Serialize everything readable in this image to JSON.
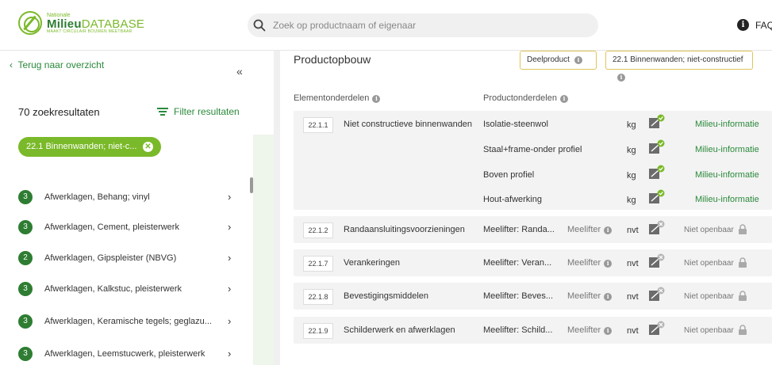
{
  "header": {
    "logo_small": "Nationale",
    "logo_brand": "Milieu",
    "logo_brand_suffix": "DATABASE",
    "logo_tagline": "MAAKT CIRCULAIR BOUWEN MEETBAAR",
    "search_placeholder": "Zoek op productnaam of eigenaar",
    "info_glyph": "i",
    "faq_label": "FAQ"
  },
  "sidebar": {
    "back_label": "Terug naar overzicht",
    "collapse_glyph": "«",
    "result_count": "70 zoekresultaten",
    "filter_label": "Filter resultaten",
    "active_filter": "22.1 Binnenwanden; niet-c...",
    "items": [
      {
        "count": "3",
        "label": "Afwerklagen, Behang; vinyl"
      },
      {
        "count": "3",
        "label": "Afwerklagen, Cement, pleisterwerk"
      },
      {
        "count": "2",
        "label": "Afwerklagen, Gipspleister (NBVG)"
      },
      {
        "count": "3",
        "label": "Afwerklagen, Kalkstuc, pleisterwerk"
      },
      {
        "count": "3",
        "label": "Afwerklagen, Keramische tegels; geglazu..."
      },
      {
        "count": "3",
        "label": "Afwerklagen, Leemstucwerk, pleisterwerk"
      }
    ]
  },
  "main": {
    "title": "Productopbouw",
    "tag_deelproduct": "Deelproduct",
    "tag_category": "22.1 Binnenwanden; niet-constructief",
    "col_elements": "Elementonderdelen",
    "col_products": "Productonderdelen",
    "first_row": {
      "code": "22.1.1",
      "element": "Niet constructieve binnenwanden",
      "parts": [
        {
          "product": "Isolatie-steenwol",
          "unit": "kg",
          "link": "Milieu-informatie"
        },
        {
          "product": "Staal+frame-onder profiel",
          "unit": "kg",
          "link": "Milieu-informatie"
        },
        {
          "product": "Boven profiel",
          "unit": "kg",
          "link": "Milieu-informatie"
        },
        {
          "product": "Hout-afwerking",
          "unit": "kg",
          "link": "Milieu-informatie"
        }
      ]
    },
    "rows": [
      {
        "code": "22.1.2",
        "element": "Randaansluitingsvoorzieningen",
        "product": "Meelifter: Randa...",
        "meelifter": "Meelifter",
        "unit": "nvt",
        "status": "Niet openbaar"
      },
      {
        "code": "22.1.7",
        "element": "Verankeringen",
        "product": "Meelifter: Veran...",
        "meelifter": "Meelifter",
        "unit": "nvt",
        "status": "Niet openbaar"
      },
      {
        "code": "22.1.8",
        "element": "Bevestigingsmiddelen",
        "product": "Meelifter: Beves...",
        "meelifter": "Meelifter",
        "unit": "nvt",
        "status": "Niet openbaar"
      },
      {
        "code": "22.1.9",
        "element": "Schilderwerk en afwerklagen",
        "product": "Meelifter: Schild...",
        "meelifter": "Meelifter",
        "unit": "nvt",
        "status": "Niet openbaar"
      }
    ]
  },
  "colors": {
    "green_dark": "#2e7d32",
    "green_light": "#7ab929",
    "link_green": "#2a8a3b",
    "tag_border": "#e0c45c"
  }
}
